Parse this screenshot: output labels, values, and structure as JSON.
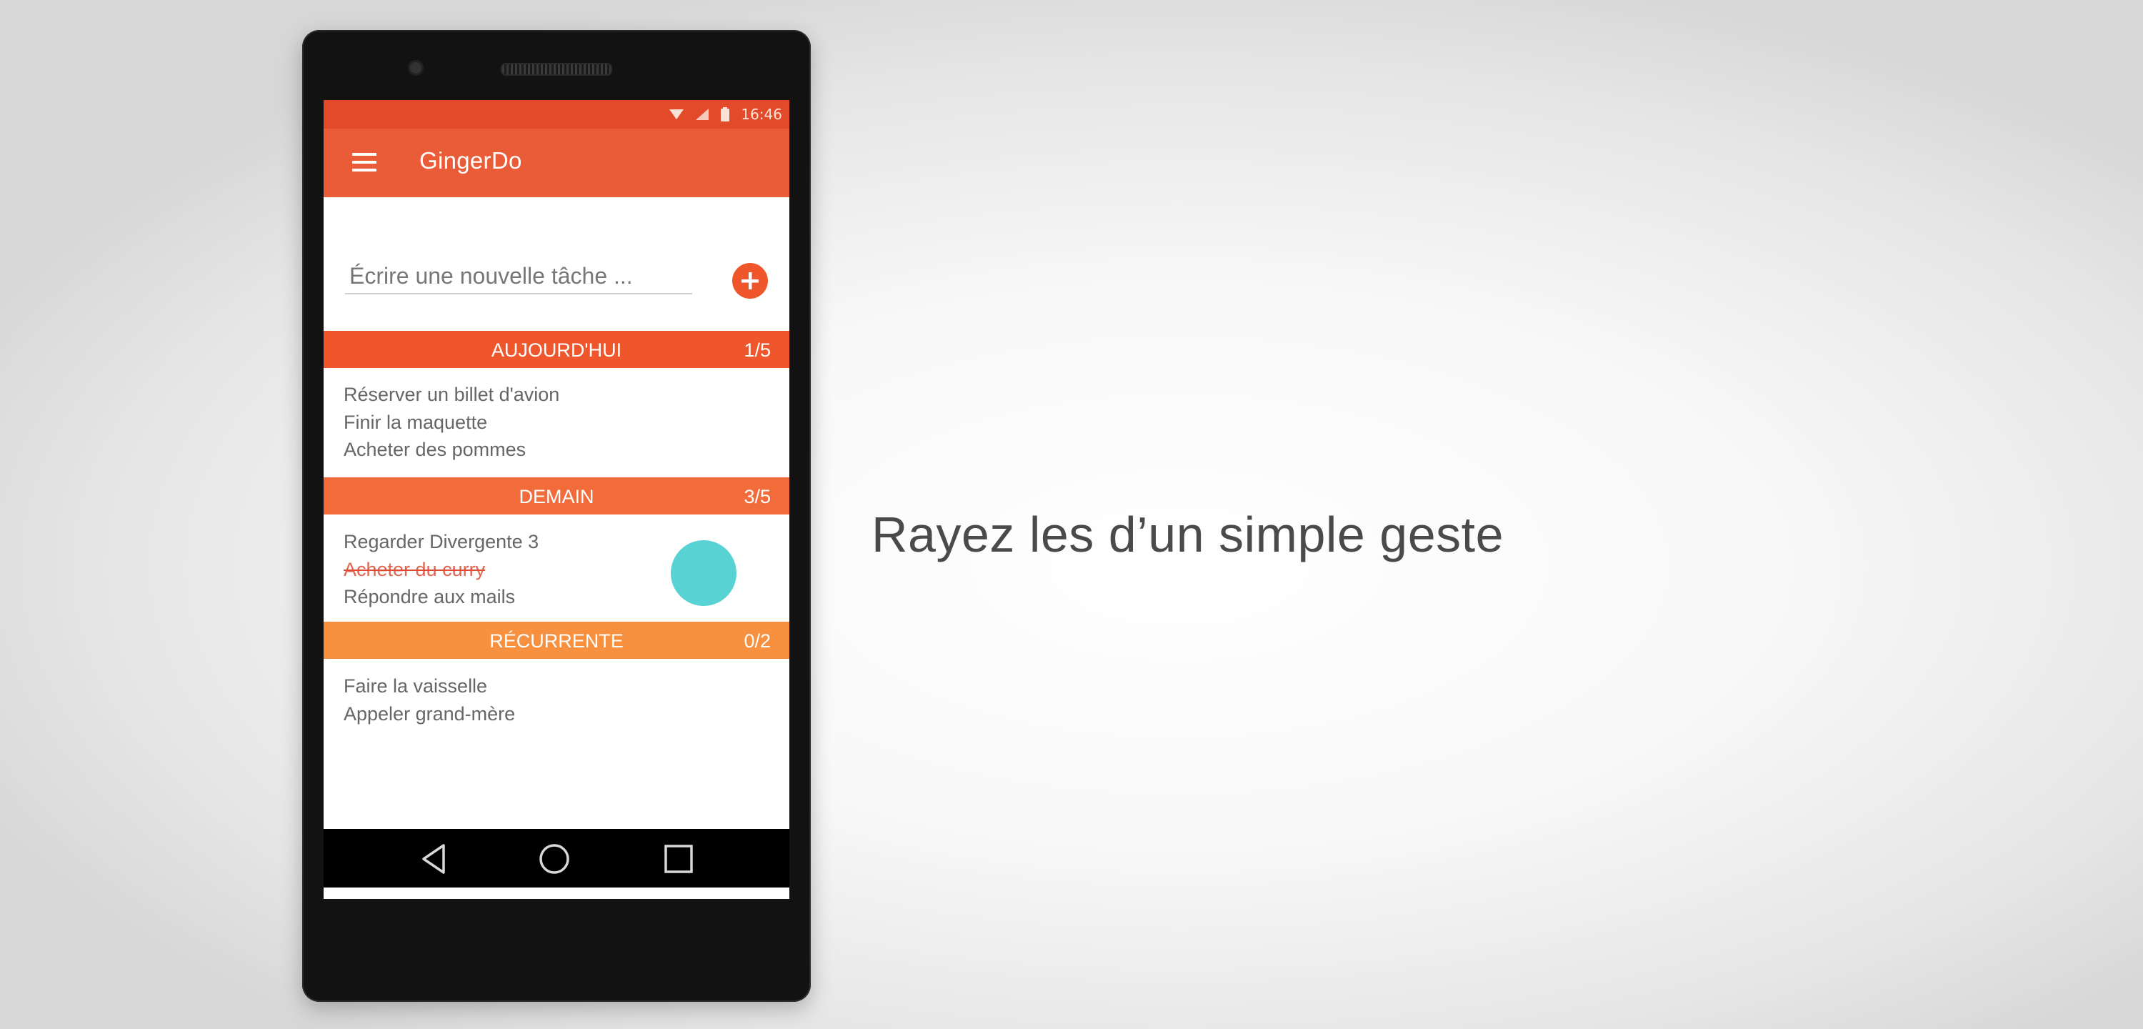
{
  "status_bar": {
    "time": "16:46",
    "icons": [
      "wifi-icon",
      "signal-icon",
      "battery-icon"
    ]
  },
  "app": {
    "title": "GingerDo",
    "menu_icon": "hamburger-menu-icon"
  },
  "new_task": {
    "placeholder": "Écrire une nouvelle tâche ...",
    "add_icon": "plus-circle-icon"
  },
  "sections": [
    {
      "title": "AUJOURD'HUI",
      "count": "1/5",
      "color": "#f0562c",
      "tasks": [
        {
          "label": "Réserver un billet d'avion",
          "done": false
        },
        {
          "label": "Finir la maquette",
          "done": false
        },
        {
          "label": "Acheter des pommes",
          "done": false
        }
      ]
    },
    {
      "title": "DEMAIN",
      "count": "3/5",
      "color": "#f26b3a",
      "tasks": [
        {
          "label": "Regarder Divergente 3",
          "done": false
        },
        {
          "label": "Acheter du curry ",
          "done": true
        },
        {
          "label": "Répondre aux mails",
          "done": false
        }
      ]
    },
    {
      "title": "RÉCURRENTE",
      "count": "0/2",
      "color": "#f7913f",
      "tasks": [
        {
          "label": "Faire la vaisselle",
          "done": false
        },
        {
          "label": "Appeler grand-mère",
          "done": false
        }
      ]
    }
  ],
  "nav": {
    "icons": [
      "back-icon",
      "home-icon",
      "recents-icon"
    ]
  },
  "caption": "Rayez les d’un simple geste",
  "colors": {
    "status_bar": "#e34a2a",
    "toolbar": "#ea5b37",
    "accent": "#f0562c",
    "touch_indicator": "#4fd0d0"
  }
}
